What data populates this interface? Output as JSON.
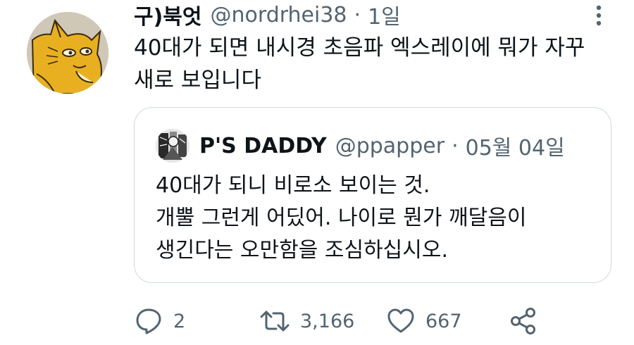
{
  "tweet": {
    "author_name": "구)북엇",
    "author_handle": "@nordrhei38",
    "separator": "·",
    "time": "1일",
    "text_lines": [
      "40대가 되면 내시경 초음파 엑스레이에 뭐가 자꾸",
      "새로 보입니다"
    ],
    "avatar_icon": "cartoon-cat-avatar",
    "more_icon": "more-vertical-icon"
  },
  "quote": {
    "author_name": "P'S DADDY",
    "author_handle": "@ppapper",
    "separator": "·",
    "time": "05월 04일",
    "text_lines": [
      "40대가 되니 비로소 보이는 것.",
      "개뿔 그런게 어딨어. 나이로 뭔가 깨달음이",
      "생긴다는 오만함을 조심하십시오."
    ],
    "avatar_icon": "manga-avatar"
  },
  "actions": {
    "reply_count": "2",
    "retweet_count": "3,166",
    "like_count": "667",
    "icons": [
      "reply-icon",
      "retweet-icon",
      "like-icon",
      "share-icon"
    ]
  },
  "colors": {
    "text": "#0f1419",
    "secondary": "#536471",
    "border": "#cfd9de",
    "avatar_yellow": "#e8b020"
  }
}
